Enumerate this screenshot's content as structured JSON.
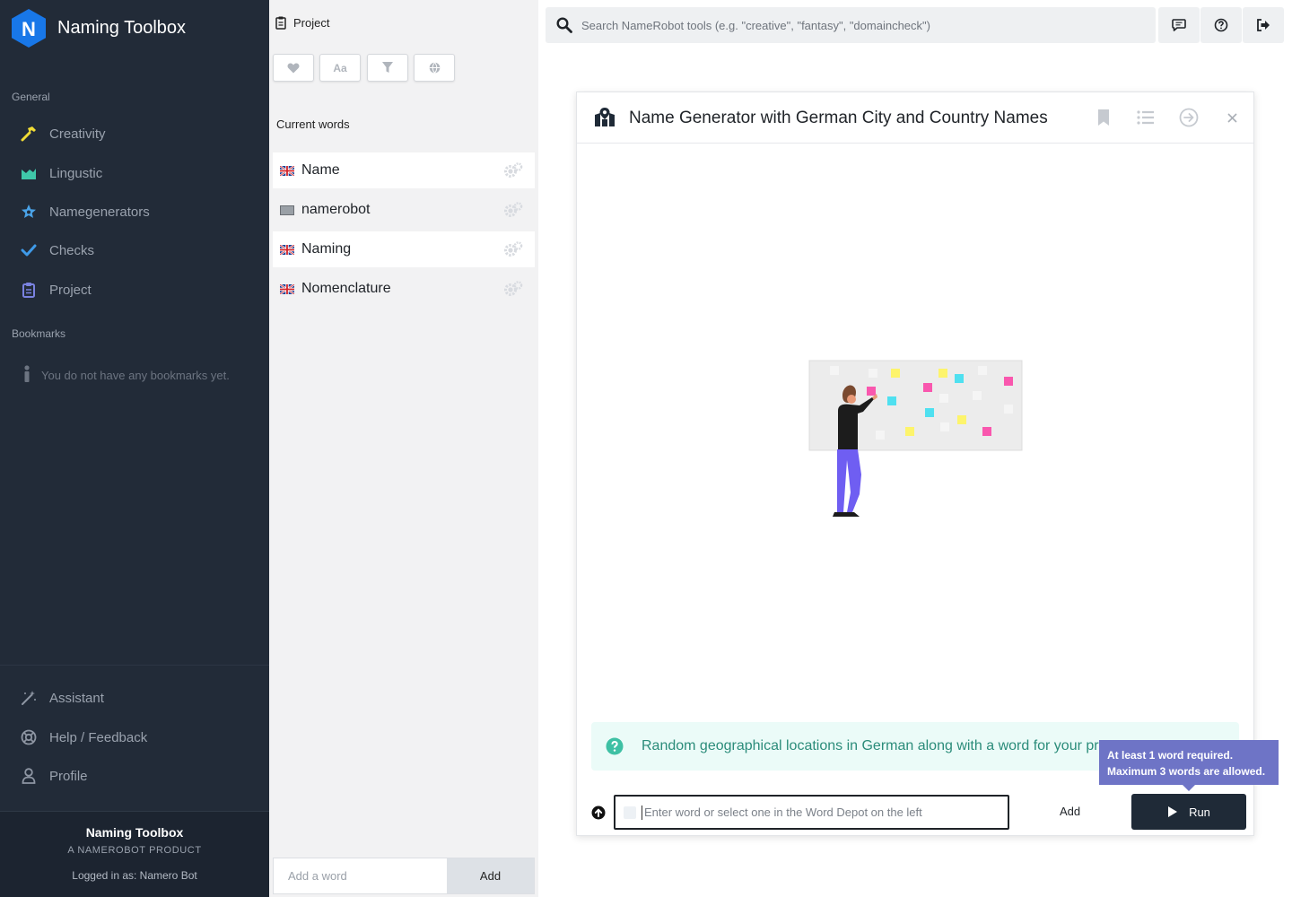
{
  "app": {
    "title": "Naming Toolbox",
    "logo_letter": "N"
  },
  "sidebar": {
    "general_label": "General",
    "items": [
      {
        "label": "Creativity",
        "icon": "hammer-icon",
        "color": "#f1dc35"
      },
      {
        "label": "Lingustic",
        "icon": "chart-icon",
        "color": "#3fc8a9"
      },
      {
        "label": "Namegenerators",
        "icon": "star-badge-icon",
        "color": "#4aa3e8"
      },
      {
        "label": "Checks",
        "icon": "check-icon",
        "color": "#3f9ae8"
      },
      {
        "label": "Project",
        "icon": "clipboard-icon",
        "color": "#7a82e0"
      }
    ],
    "bookmarks_label": "Bookmarks",
    "bookmarks_empty": "You do not have any bookmarks yet.",
    "bottom_items": [
      {
        "label": "Assistant",
        "icon": "magic-wand-icon"
      },
      {
        "label": "Help / Feedback",
        "icon": "lifebuoy-icon"
      },
      {
        "label": "Profile",
        "icon": "user-icon"
      }
    ],
    "footer": {
      "title": "Naming Toolbox",
      "subtitle": "A NAMEROBOT PRODUCT",
      "logged_in": "Logged in as: Namero Bot"
    }
  },
  "depot": {
    "header": "Project",
    "filters": [
      "heart-icon",
      "font-case-icon",
      "filter-icon",
      "globe-icon"
    ],
    "filter_font_label": "Aa",
    "current_words_label": "Current words",
    "words": [
      {
        "label": "Name",
        "flag": "uk",
        "highlighted": true
      },
      {
        "label": "namerobot",
        "flag": "unknown",
        "highlighted": false
      },
      {
        "label": "Naming",
        "flag": "uk",
        "highlighted": true
      },
      {
        "label": "Nomenclature",
        "flag": "uk",
        "highlighted": false
      }
    ],
    "add_placeholder": "Add a word",
    "add_button": "Add"
  },
  "search": {
    "placeholder": "Search NameRobot tools (e.g. \"creative\", \"fantasy\", \"domaincheck\")"
  },
  "top_buttons": [
    "chat-icon",
    "help-icon",
    "logout-icon"
  ],
  "tool": {
    "title": "Name Generator with German City and Country Names",
    "icon": "map-pin-icon",
    "header_buttons": [
      "bookmark-icon",
      "list-icon",
      "arrow-right-circle-icon",
      "close-icon"
    ],
    "info_text": "Random geographical locations in German along with a word for your pr",
    "input_placeholder": "Enter word or select one in the Word Depot on the left",
    "add_label": "Add",
    "run_label": "Run",
    "tooltip_line1": "At least 1 word required.",
    "tooltip_line2": "Maximum 3 words are allowed."
  }
}
